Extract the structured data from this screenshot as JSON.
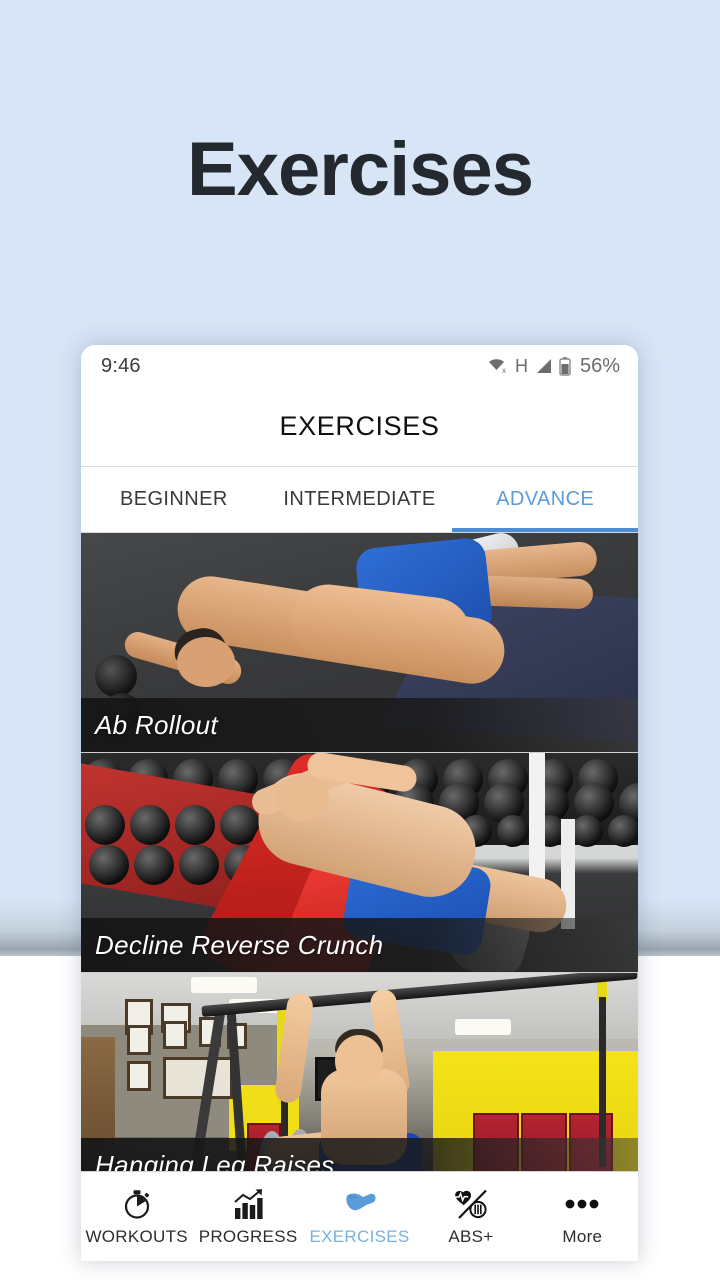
{
  "page": {
    "headline": "Exercises",
    "background_color": "#d7e5f6",
    "accent_color": "#5b9bd9"
  },
  "phone": {
    "status_bar": {
      "clock": "9:46",
      "network_letter": "H",
      "battery_percent": "56%",
      "icons": [
        "wifi-off-icon",
        "signal-icon",
        "battery-icon"
      ]
    },
    "app_bar": {
      "title": "EXERCISES"
    },
    "tabs": [
      {
        "label": "BEGINNER",
        "active": false
      },
      {
        "label": "INTERMEDIATE",
        "active": false
      },
      {
        "label": "ADVANCE",
        "active": true
      }
    ],
    "exercises": [
      {
        "name": "Ab Rollout"
      },
      {
        "name": "Decline Reverse Crunch"
      },
      {
        "name": "Hanging Leg Raises"
      }
    ],
    "bottom_nav": [
      {
        "label": "WORKOUTS",
        "icon": "stopwatch-icon",
        "active": false
      },
      {
        "label": "PROGRESS",
        "icon": "bar-chart-icon",
        "active": false
      },
      {
        "label": "EXERCISES",
        "icon": "flexed-arm-icon",
        "active": true
      },
      {
        "label": "ABS+",
        "icon": "heart-diet-icon",
        "active": false
      },
      {
        "label": "More",
        "icon": "ellipsis-icon",
        "active": false
      }
    ]
  }
}
